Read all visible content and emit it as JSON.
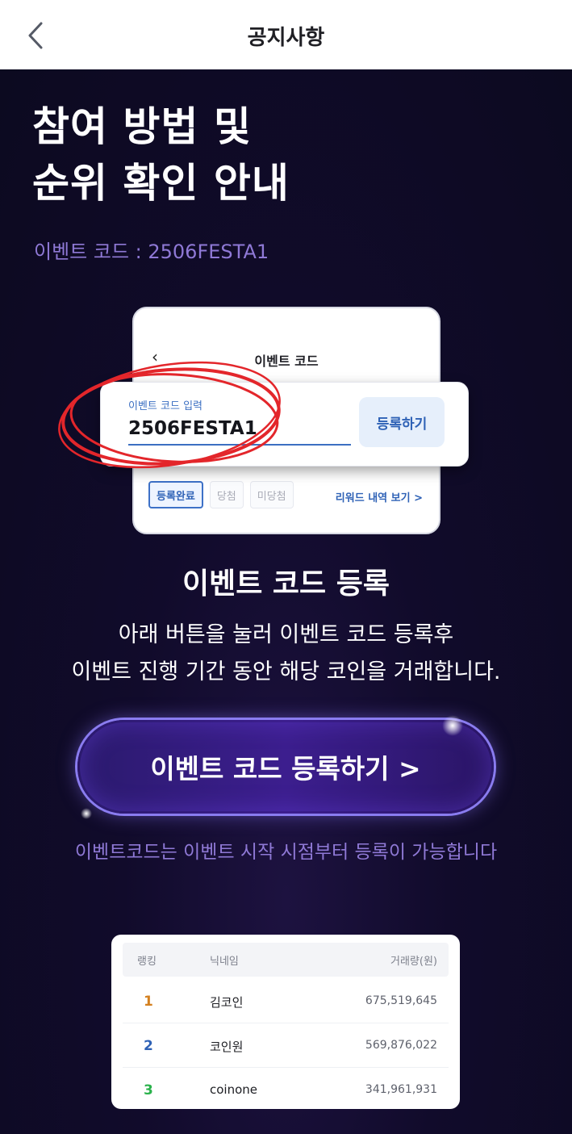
{
  "header": {
    "title": "공지사항",
    "back_icon": "chevron-left-icon"
  },
  "hero": {
    "headline_line1": "참여 방법 및",
    "headline_line2": "순위 확인 안내",
    "event_code_label": "이벤트 코드 : 2506FESTA1"
  },
  "mockup": {
    "title": "이벤트 코드",
    "input_label": "이벤트 코드 입력",
    "input_value": "2506FESTA1",
    "register_button": "등록하기",
    "tabs": [
      "등록완료",
      "당첨",
      "미당첨"
    ],
    "active_tab": "등록완료",
    "reward_link": "리워드 내역 보기 >"
  },
  "registration": {
    "title": "이벤트 코드 등록",
    "desc_line1": "아래 버튼을 눌러 이벤트 코드 등록후",
    "desc_line2": "이벤트 진행 기간 동안 해당 코인을 거래합니다.",
    "cta_label": "이벤트 코드 등록하기 >",
    "note": "이벤트코드는 이벤트 시작 시점부터 등록이 가능합니다"
  },
  "ranking": {
    "columns": [
      "랭킹",
      "닉네임",
      "거래량(원)"
    ],
    "rows": [
      {
        "rank": "1",
        "nickname": "김코인",
        "volume": "675,519,645",
        "color": "#d4801f"
      },
      {
        "rank": "2",
        "nickname": "코인원",
        "volume": "569,876,022",
        "color": "#2f62b6"
      },
      {
        "rank": "3",
        "nickname": "coinone",
        "volume": "341,961,931",
        "color": "#2bb24c"
      }
    ]
  },
  "colors": {
    "background": "#0e0b24",
    "accent_purple": "#8f79d6",
    "cta_border": "#8a7cf0"
  }
}
